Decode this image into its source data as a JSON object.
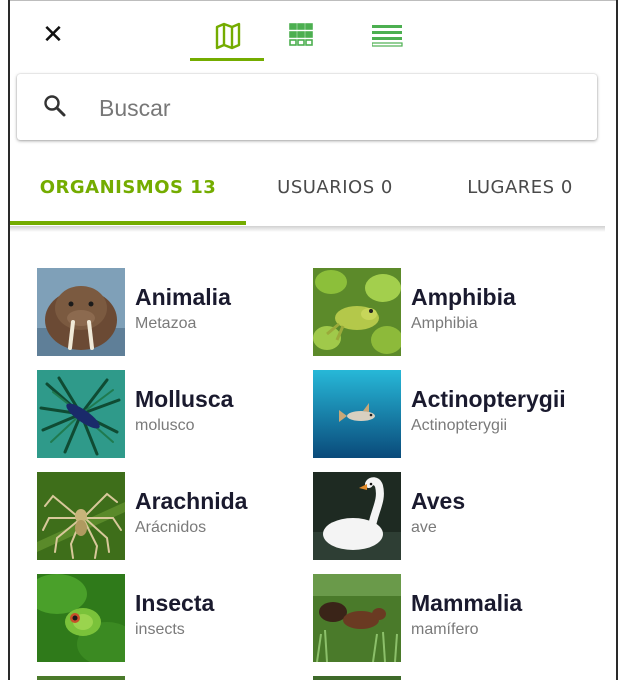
{
  "toolbar": {
    "close_icon": "close-icon",
    "views": [
      {
        "name": "map-view",
        "icon": "map-icon",
        "active": true
      },
      {
        "name": "grid-view",
        "icon": "grid-icon",
        "active": false
      },
      {
        "name": "list-view",
        "icon": "list-icon",
        "active": false
      }
    ]
  },
  "search": {
    "placeholder": "Buscar",
    "value": ""
  },
  "tabs": [
    {
      "label": "ORGANISMOS 13",
      "active": true
    },
    {
      "label": "USUARIOS 0",
      "active": false
    },
    {
      "label": "LUGARES 0",
      "active": false
    }
  ],
  "taxa": [
    {
      "name": "Animalia",
      "common": "Metazoa"
    },
    {
      "name": "Amphibia",
      "common": "Amphibia"
    },
    {
      "name": "Mollusca",
      "common": "molusco"
    },
    {
      "name": "Actinopterygii",
      "common": "Actinopterygii"
    },
    {
      "name": "Arachnida",
      "common": "Arácnidos"
    },
    {
      "name": "Aves",
      "common": "ave"
    },
    {
      "name": "Insecta",
      "common": "insects"
    },
    {
      "name": "Mammalia",
      "common": "mamífero"
    }
  ],
  "colors": {
    "accent": "#74ac00",
    "title": "#1a1a2e",
    "subtitle": "#7a7a7a"
  }
}
